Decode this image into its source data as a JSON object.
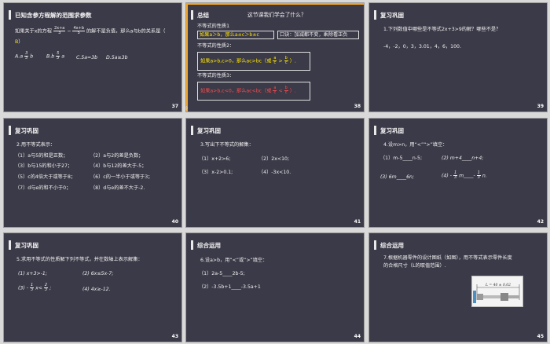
{
  "slides": [
    {
      "num": "37",
      "title": "已知含参方程解的范围求参数",
      "line1": "如果关于x的方程",
      "frac1_n": "2x+a",
      "frac1_d": "3",
      "minus": "−",
      "frac2_n": "4x+b",
      "frac2_d": "5",
      "line1_tail": "的解不是负值，那么a与b的关系是（",
      "answer": "B",
      "close_paren": "）",
      "optA": "A.a",
      "optA_frac_n": "3",
      "optA_frac_d": "5",
      "optA_tail": "b",
      "optB": "B.b",
      "optB_frac_n": "5",
      "optB_frac_d": "3",
      "optB_tail": "a",
      "optC": "C.5a=3b",
      "optD": "D.5a≥3b"
    },
    {
      "num": "38",
      "title": "总结",
      "question": "这节课我们学会了什么？",
      "p1_label": "不等式的性质1",
      "p1_text": "如果a＞b，那么a±c＞b±c",
      "p1_note": "口诀：加减都不变，乘除看正负",
      "p2_label": "不等式的性质2：",
      "p2_text": "如果a>b,c>0，那么ac>bc（或",
      "p2_frac_n1": "a",
      "p2_frac_d1": "c",
      "p2_gt": ">",
      "p2_frac_n2": "b",
      "p2_frac_d2": "c",
      "p2_close": "）.",
      "p3_label": "不等式的性质3：",
      "p3_text": "如果a>b,c<0，那么ac<bc（或",
      "p3_frac_n1": "a",
      "p3_frac_d1": "c",
      "p3_lt": "<",
      "p3_frac_n2": "b",
      "p3_frac_d2": "c",
      "p3_close": "）.",
      "side_mark": "冷"
    },
    {
      "num": "39",
      "title": "复习巩固",
      "line1": "1.下列数值中哪些是不等式2x+3>9的解？哪些不是？",
      "line2": "-4，-2，0，3，3.01，4，6，100."
    },
    {
      "num": "40",
      "title": "复习巩固",
      "intro": "2.用不等式表示：",
      "items": [
        "（1）a与5的和是正数；",
        "（2）a与2的差是负数；",
        "（3）b与15的和小于27；",
        "（4）b与12的差大于-5；",
        "（5）c的4倍大于或等于8；",
        "（6）c的一半小于或等于3；",
        "（7）d与e的和不小于0；",
        "（8）d与e的差不大于-2."
      ]
    },
    {
      "num": "41",
      "title": "复习巩固",
      "intro": "3.写出下不等式的解集：",
      "items": [
        "（1）x+2>6;",
        "（2）2x<10;",
        "（3）x-2>0.1;",
        "（4）-3x<10."
      ]
    },
    {
      "num": "42",
      "title": "复习巩固",
      "intro": "4.设m>n，用“<”“>”填空：",
      "i1": "（1）m-5____n-5;",
      "i2": "(2) m+4____n+4;",
      "i3": "(3) 6m____6n;",
      "i4_pre": "(4) -",
      "i4_frac_n": "1",
      "i4_frac_d": "3",
      "i4_mid": "m____-",
      "i4_frac2_n": "1",
      "i4_frac2_d": "3",
      "i4_tail": "n."
    },
    {
      "num": "43",
      "title": "复习巩固",
      "intro": "5.求用不等式的性质解下列不等式，并在数轴上表示解集：",
      "i1": "(1) x+3>-1;",
      "i2": "(2) 6x≤5x-7;",
      "i3_pre": "(3) -",
      "i3_frac_n": "1",
      "i3_frac_d": "3",
      "i3_mid": "x<",
      "i3_frac2_n": "2",
      "i3_frac2_d": "3",
      "i3_tail": ";",
      "i4": "(4) 4x≥-12."
    },
    {
      "num": "44",
      "title": "综合运用",
      "intro": "6.设a>b，用“<”或“>”填空：",
      "i1": "（1）2a-5____2b-5;",
      "i2": "（2）-3.5b+1____-3.5a+1"
    },
    {
      "num": "45",
      "title": "综合运用",
      "line1": "7.根据机器零件的设计图纸（如图），用不等式表示零件长度",
      "line2": "的合格尺寸（L的取值范围）.",
      "fig_label": "L = 40 ± 0.02"
    }
  ],
  "colors": {
    "slide_bg": "#3b3a48",
    "page_bg": "#d9d9d9",
    "highlight": "#ffe600",
    "red": "#ff4a4a",
    "selected_border": "#f5a623"
  }
}
